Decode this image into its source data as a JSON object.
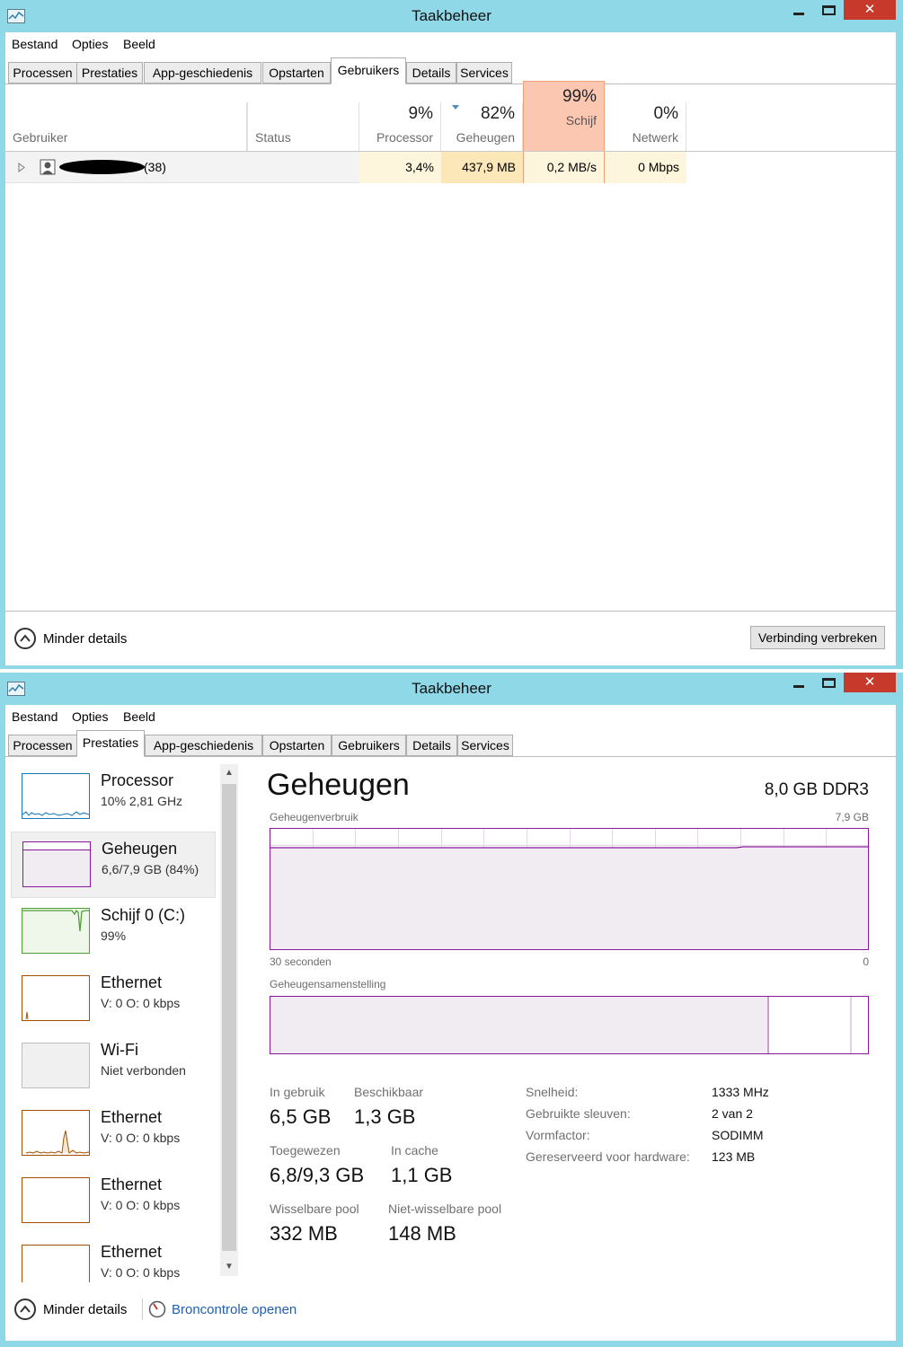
{
  "title": "Taakbeheer",
  "menu": [
    "Bestand",
    "Opties",
    "Beeld"
  ],
  "tabs": [
    "Processen",
    "Prestaties",
    "App-geschiedenis",
    "Opstarten",
    "Gebruikers",
    "Details",
    "Services"
  ],
  "users_view": {
    "active_tab": "Gebruikers",
    "columns": {
      "user": "Gebruiker",
      "status": "Status",
      "cpu": {
        "pct": "9%",
        "label": "Processor"
      },
      "memory": {
        "pct": "82%",
        "label": "Geheugen"
      },
      "disk": {
        "pct": "99%",
        "label": "Schijf"
      },
      "network": {
        "pct": "0%",
        "label": "Netwerk"
      }
    },
    "row": {
      "name_suffix": "(38)",
      "cpu": "3,4%",
      "memory": "437,9 MB",
      "disk": "0,2 MB/s",
      "network": "0 Mbps"
    },
    "footer": {
      "less_details": "Minder details",
      "disconnect": "Verbinding verbreken"
    }
  },
  "perf_view": {
    "active_tab": "Prestaties",
    "sidebar": [
      {
        "title": "Processor",
        "sub": "10%  2,81 GHz",
        "color": "#1779ba"
      },
      {
        "title": "Geheugen",
        "sub": "6,6/7,9 GB (84%)",
        "color": "#8b179e"
      },
      {
        "title": "Schijf 0 (C:)",
        "sub": "99%",
        "color": "#4da033"
      },
      {
        "title": "Ethernet",
        "sub": "V: 0  O: 0 kbps",
        "color": "#a74f01"
      },
      {
        "title": "Wi-Fi",
        "sub": "Niet verbonden",
        "color": "#bdbdbd"
      },
      {
        "title": "Ethernet",
        "sub": "V: 0  O: 0 kbps",
        "color": "#a74f01"
      },
      {
        "title": "Ethernet",
        "sub": "V: 0  O: 0 kbps",
        "color": "#a74f01"
      },
      {
        "title": "Ethernet",
        "sub": "V: 0  O: 0 kbps",
        "color": "#a74f01"
      }
    ],
    "heading": "Geheugen",
    "total": "8,0 GB DDR3",
    "usage_chart": {
      "label": "Geheugenverbruik",
      "max": "7,9 GB",
      "time": "30 seconden",
      "min": "0",
      "used_fraction": 0.84
    },
    "composition_label": "Geheugensamenstelling",
    "stats": {
      "in_use": {
        "label": "In gebruik",
        "value": "6,5 GB"
      },
      "available": {
        "label": "Beschikbaar",
        "value": "1,3 GB"
      },
      "committed": {
        "label": "Toegewezen",
        "value": "6,8/9,3 GB"
      },
      "cached": {
        "label": "In cache",
        "value": "1,1 GB"
      },
      "paged_pool": {
        "label": "Wisselbare pool",
        "value": "332 MB"
      },
      "nonpaged_pool": {
        "label": "Niet-wisselbare pool",
        "value": "148 MB"
      }
    },
    "details": [
      {
        "label": "Snelheid:",
        "value": "1333 MHz"
      },
      {
        "label": "Gebruikte sleuven:",
        "value": "2 van 2"
      },
      {
        "label": "Vormfactor:",
        "value": "SODIMM"
      },
      {
        "label": "Gereserveerd voor hardware:",
        "value": "123 MB"
      }
    ],
    "footer": {
      "less_details": "Minder details",
      "resource_monitor": "Broncontrole openen"
    }
  }
}
